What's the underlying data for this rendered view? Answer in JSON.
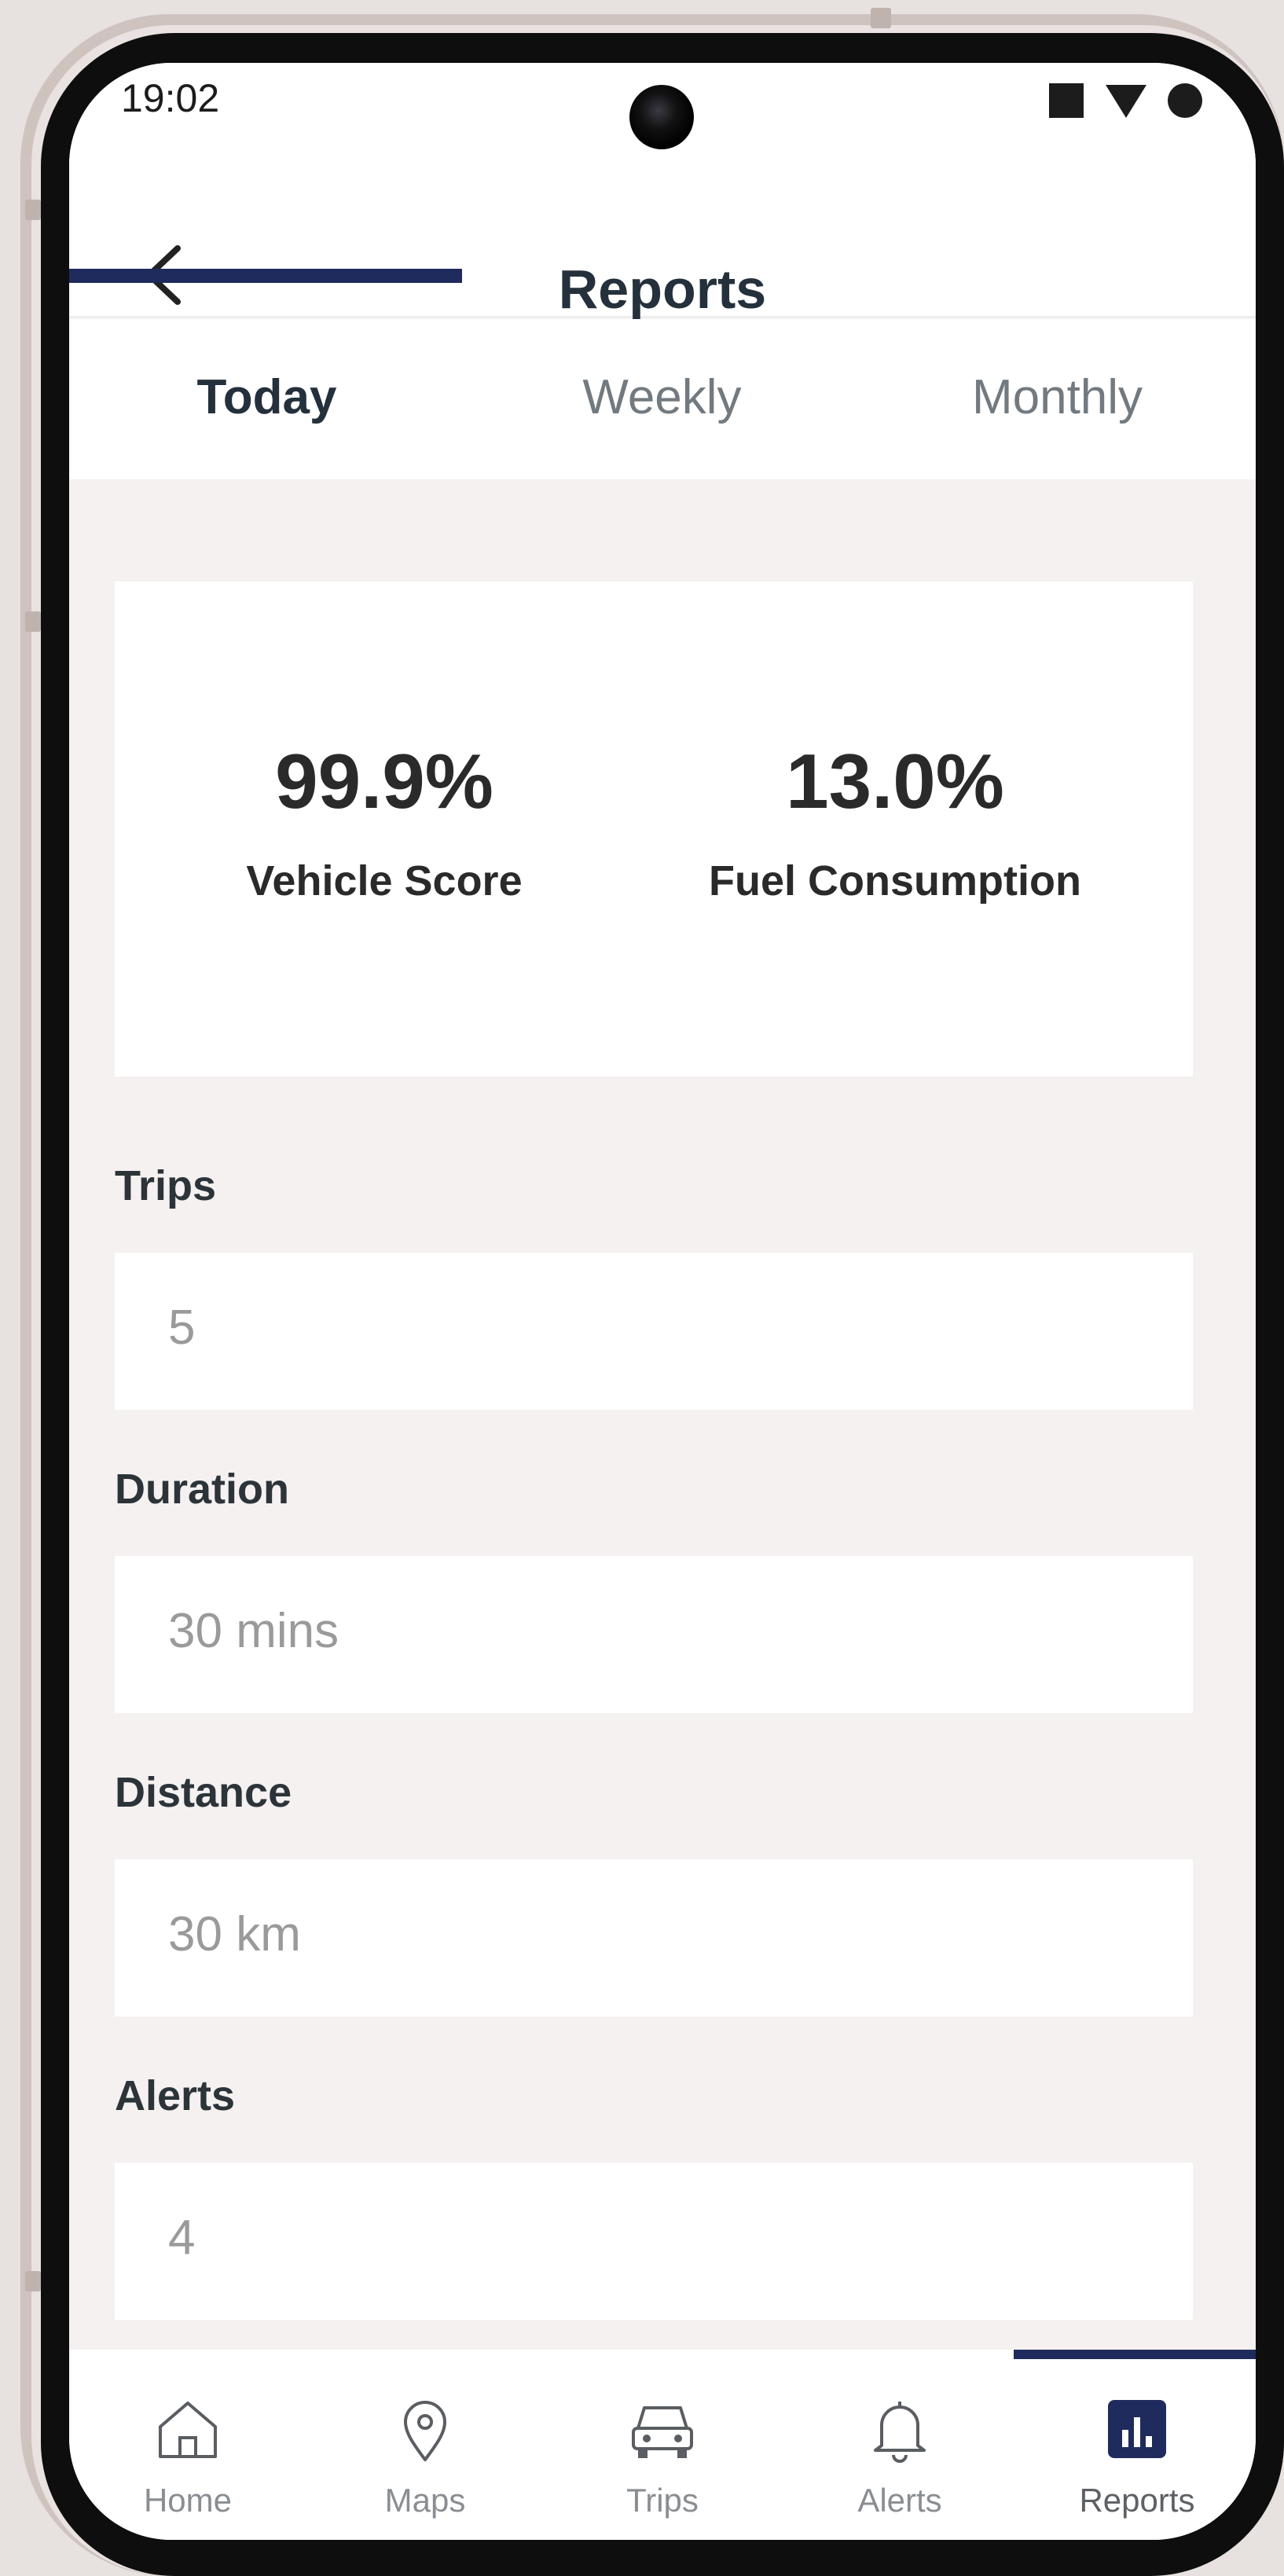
{
  "status_bar": {
    "time": "19:02"
  },
  "header": {
    "title": "Reports"
  },
  "tabs": [
    {
      "label": "Today",
      "active": true
    },
    {
      "label": "Weekly",
      "active": false
    },
    {
      "label": "Monthly",
      "active": false
    }
  ],
  "summary": {
    "vehicle_score": {
      "value": "99.9%",
      "label": "Vehicle Score"
    },
    "fuel_consumption": {
      "value": "13.0%",
      "label": "Fuel Consumption"
    }
  },
  "stats": {
    "trips": {
      "label": "Trips",
      "value": "5"
    },
    "duration": {
      "label": "Duration",
      "value": "30 mins"
    },
    "distance": {
      "label": "Distance",
      "value": "30 km"
    },
    "alerts": {
      "label": "Alerts",
      "value": "4"
    }
  },
  "bottom_nav": [
    {
      "label": "Home",
      "icon": "home-icon",
      "active": false
    },
    {
      "label": "Maps",
      "icon": "map-pin-icon",
      "active": false
    },
    {
      "label": "Trips",
      "icon": "car-icon",
      "active": false
    },
    {
      "label": "Alerts",
      "icon": "bell-icon",
      "active": false
    },
    {
      "label": "Reports",
      "icon": "bar-chart-icon",
      "active": true
    }
  ],
  "colors": {
    "accent": "#1f2b5c",
    "title_text": "#24303b",
    "background": "#f4f1f0",
    "muted_text": "#9a9a9a"
  }
}
